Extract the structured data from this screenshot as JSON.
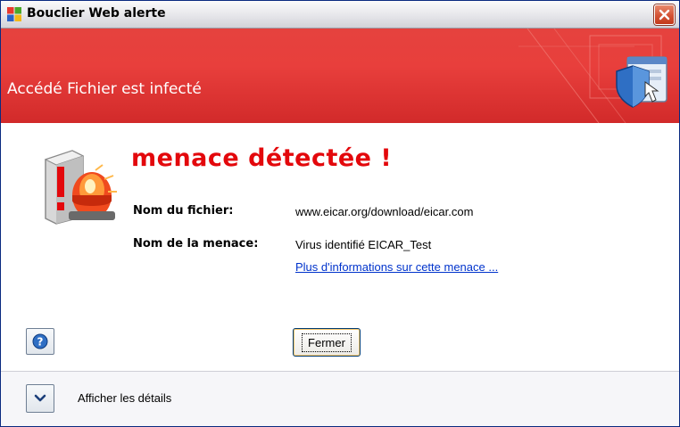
{
  "window": {
    "title": "Bouclier Web alerte"
  },
  "banner": {
    "text": "Accédé Fichier est infecté"
  },
  "alert": {
    "heading": "menace détectée !",
    "file_label": "Nom du fichier:",
    "file_value": "www.eicar.org/download/eicar.com",
    "threat_label": "Nom de la menace:",
    "threat_value": "Virus identifié EICAR_Test",
    "more_info_link": "Plus d'informations sur cette menace ..."
  },
  "buttons": {
    "close_label": "Fermer"
  },
  "footer": {
    "details_label": "Afficher les détails"
  },
  "icons": {
    "app": "avast-app-icon",
    "close": "close-icon",
    "banner": "shield-browser-icon",
    "alert": "alarm-beacon-icon",
    "help": "help-icon",
    "expand": "chevron-down-icon"
  },
  "colors": {
    "banner_red": "#e5423e",
    "heading_red": "#e3080c",
    "link_blue": "#0033cc",
    "close_button_red": "#d45234"
  }
}
